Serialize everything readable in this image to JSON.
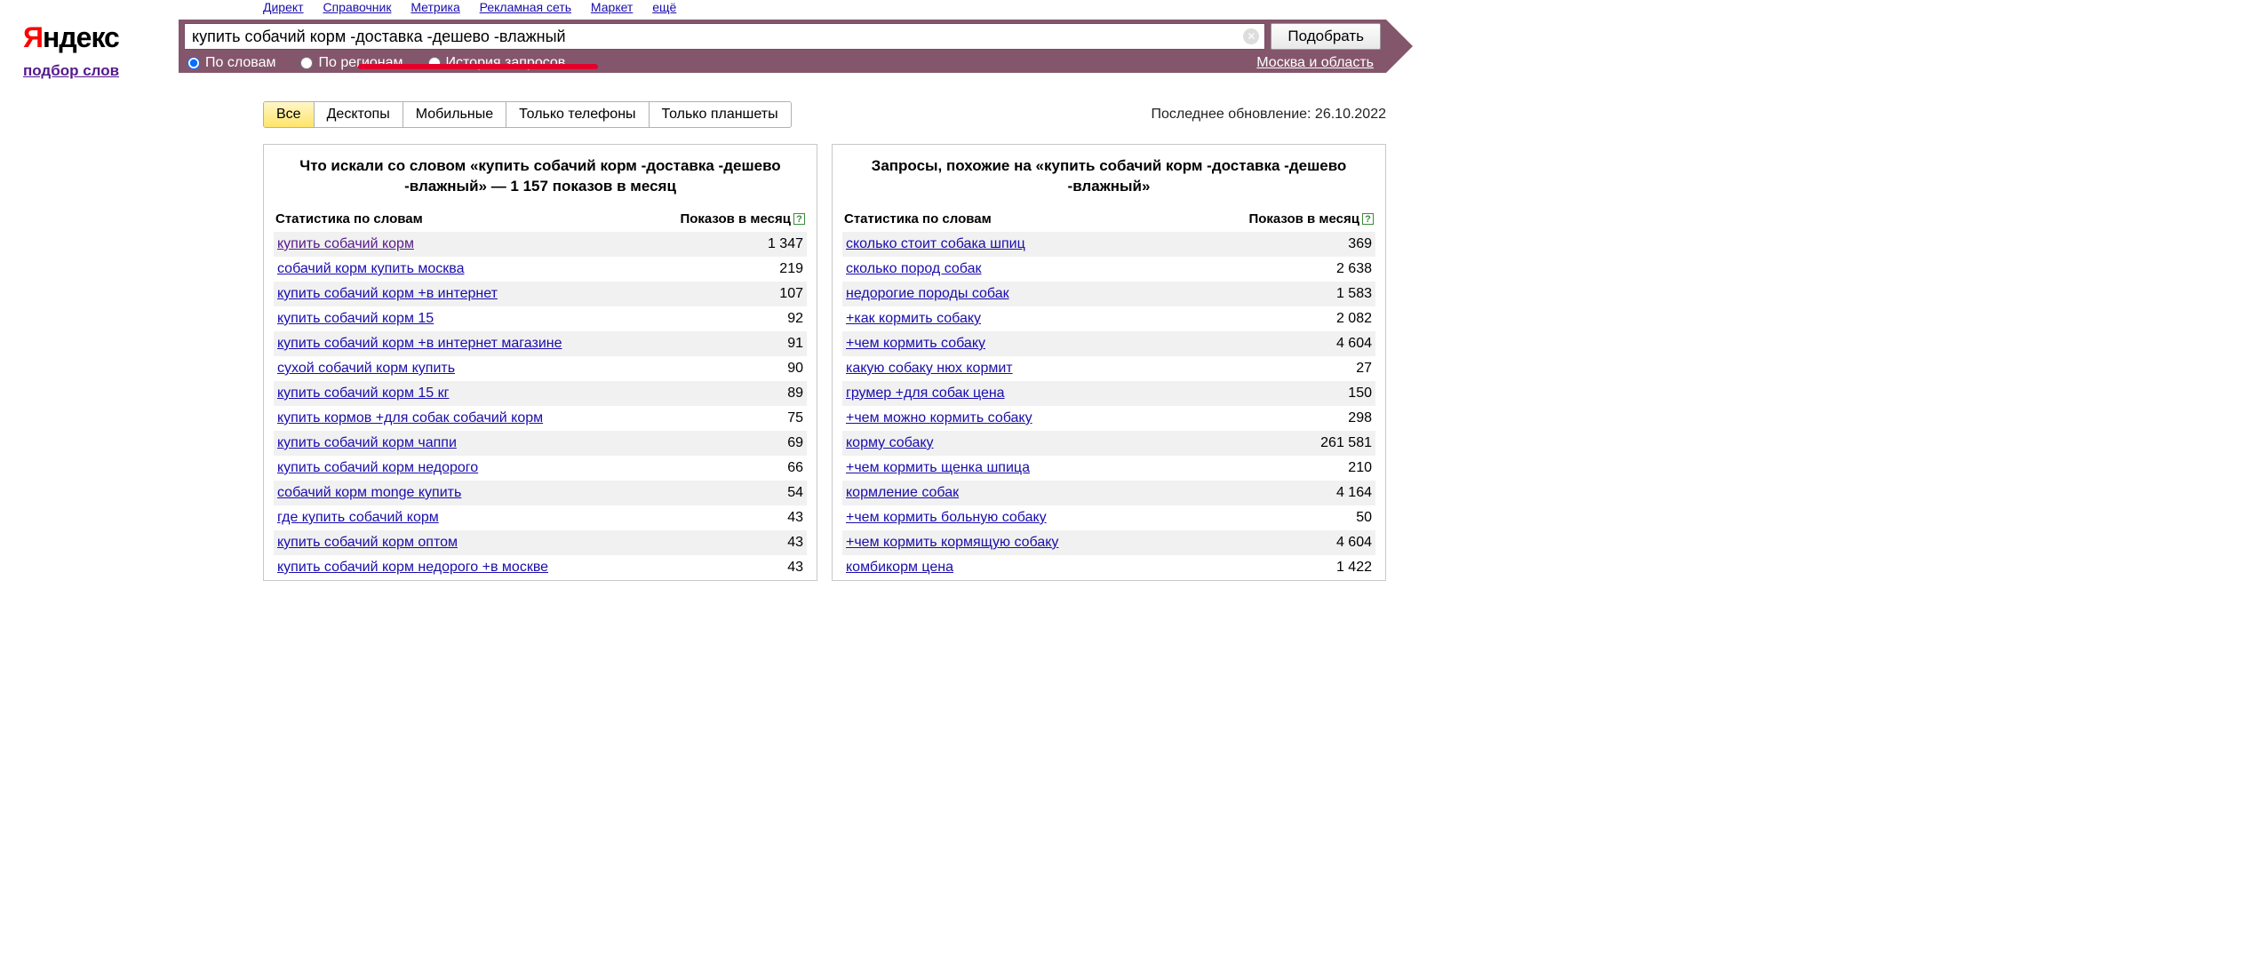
{
  "top_nav": [
    "Директ",
    "Справочник",
    "Метрика",
    "Рекламная сеть",
    "Маркет",
    "ещё"
  ],
  "logo_sub": "подбор слов",
  "search": {
    "value": "купить собачий корм -доставка -дешево -влажный",
    "submit": "Подобрать"
  },
  "radios": {
    "by_words": "По словам",
    "by_regions": "По регионам",
    "history": "История запросов"
  },
  "region": "Москва и область",
  "device_tabs": [
    "Все",
    "Десктопы",
    "Мобильные",
    "Только телефоны",
    "Только планшеты"
  ],
  "update_label": "Последнее обновление: 26.10.2022",
  "left_panel": {
    "title": "Что искали со словом «купить собачий корм -доставка -дешево -влажный» — 1 157 показов в месяц",
    "col1": "Статистика по словам",
    "col2": "Показов в месяц",
    "rows": [
      {
        "q": "купить собачий корм",
        "v": "1 347",
        "visited": true
      },
      {
        "q": "собачий корм купить москва",
        "v": "219"
      },
      {
        "q": "купить собачий корм +в интернет",
        "v": "107"
      },
      {
        "q": "купить собачий корм 15",
        "v": "92"
      },
      {
        "q": "купить собачий корм +в интернет магазине",
        "v": "91"
      },
      {
        "q": "сухой собачий корм купить",
        "v": "90"
      },
      {
        "q": "купить собачий корм 15 кг",
        "v": "89"
      },
      {
        "q": "купить кормов +для собак собачий корм",
        "v": "75"
      },
      {
        "q": "купить собачий корм чаппи",
        "v": "69"
      },
      {
        "q": "купить собачий корм недорого",
        "v": "66"
      },
      {
        "q": "собачий корм monge купить",
        "v": "54"
      },
      {
        "q": "где купить собачий корм",
        "v": "43"
      },
      {
        "q": "купить собачий корм оптом",
        "v": "43"
      },
      {
        "q": "купить собачий корм недорого +в москве",
        "v": "43"
      }
    ]
  },
  "right_panel": {
    "title": "Запросы, похожие на «купить собачий корм -доставка -дешево -влажный»",
    "col1": "Статистика по словам",
    "col2": "Показов в месяц",
    "rows": [
      {
        "q": "сколько стоит собака шпиц",
        "v": "369"
      },
      {
        "q": "сколько пород собак",
        "v": "2 638"
      },
      {
        "q": "недорогие породы собак",
        "v": "1 583"
      },
      {
        "q": "+как кормить собаку",
        "v": "2 082"
      },
      {
        "q": "+чем кормить собаку",
        "v": "4 604"
      },
      {
        "q": "какую собаку нюх кормит",
        "v": "27"
      },
      {
        "q": "грумер +для собак цена",
        "v": "150"
      },
      {
        "q": "+чем можно кормить собаку",
        "v": "298"
      },
      {
        "q": "корму собаку",
        "v": "261 581"
      },
      {
        "q": "+чем кормить щенка шпица",
        "v": "210"
      },
      {
        "q": "кормление собак",
        "v": "4 164"
      },
      {
        "q": "+чем кормить больную собаку",
        "v": "50"
      },
      {
        "q": "+чем кормить кормящую собаку",
        "v": "4 604"
      },
      {
        "q": "комбикорм цена",
        "v": "1 422"
      }
    ]
  }
}
